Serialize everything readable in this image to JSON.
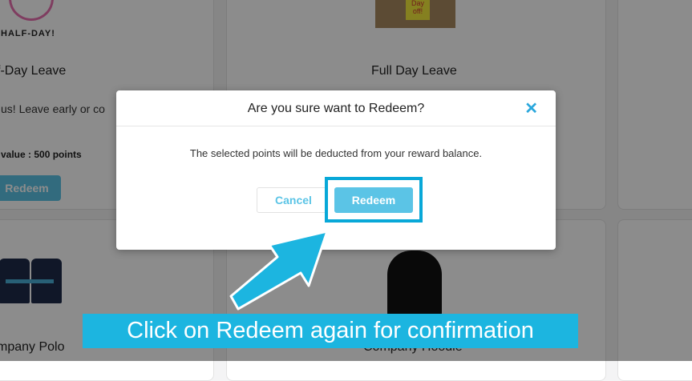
{
  "background_cards": [
    {
      "title": "f-Day Leave",
      "description": "us! Leave early or co",
      "points": "value : 500 points",
      "button": "Redeem",
      "badge": "HALF-DAY!"
    },
    {
      "title": "Full Day Leave",
      "note": "Day off!"
    },
    {
      "title": "mpany Polo"
    },
    {
      "title": "Company Hoodie"
    }
  ],
  "modal": {
    "title": "Are you sure want to Redeem?",
    "close_glyph": "✕",
    "message": "The selected points will be deducted from your reward balance.",
    "cancel_label": "Cancel",
    "redeem_label": "Redeem"
  },
  "callout": {
    "text": "Click on Redeem again for confirmation"
  },
  "colors": {
    "accent": "#5bc4e6",
    "highlight": "#08a8d8",
    "callout_bg": "#1cb5e0",
    "close": "#2aa7dc"
  }
}
